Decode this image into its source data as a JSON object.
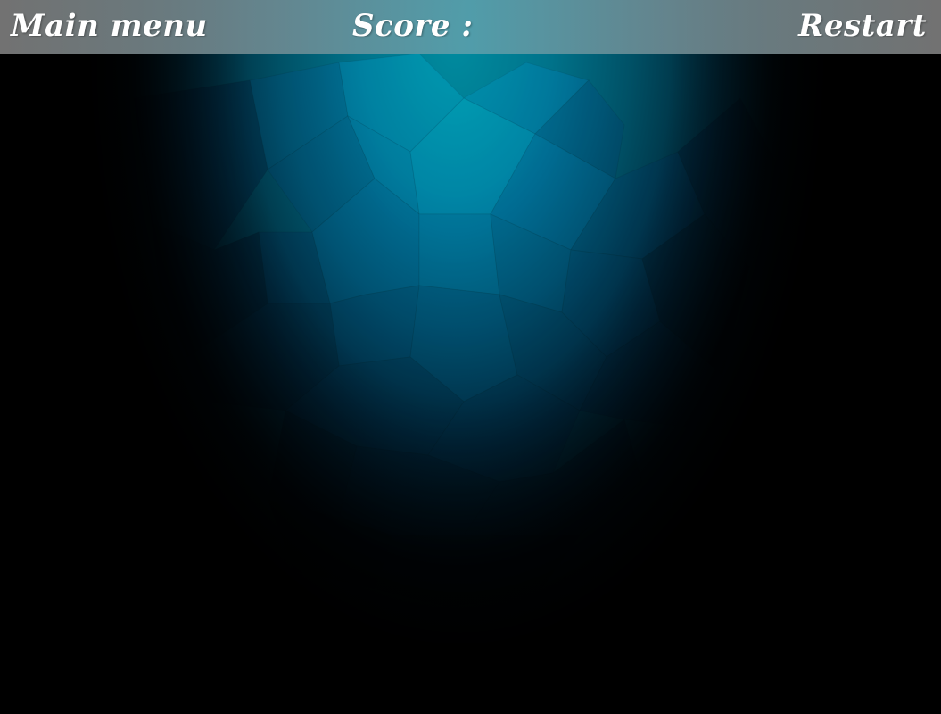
{
  "topbar": {
    "main_menu_label": "Main menu",
    "score_label": "Score :",
    "score_value": "",
    "restart_label": "Restart"
  },
  "colors": {
    "background": "#000000",
    "spotlight": "#008ca0",
    "topbar": "#6e8c94",
    "text": "#ffffff"
  }
}
